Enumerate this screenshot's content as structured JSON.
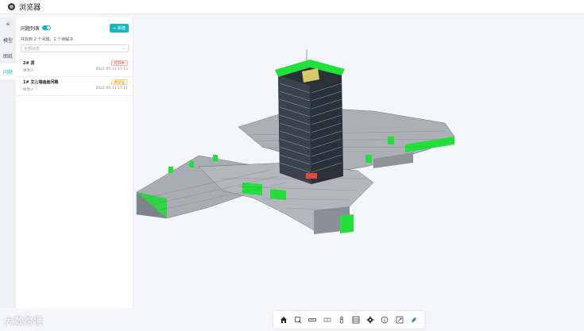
{
  "window": {
    "title": "浏览器"
  },
  "side_tabs": [
    {
      "label": "«"
    },
    {
      "label": "模型"
    },
    {
      "label": "图纸"
    },
    {
      "label": "问题"
    }
  ],
  "panel": {
    "title": "问题列表",
    "new_button": "+ 新建",
    "summary": "共找到 2 个问题，2 个待解决",
    "status_placeholder": "全部状态",
    "issues": [
      {
        "name": "2# 洞",
        "status": "打开中",
        "status_kind": "open",
        "owner": "修改人 - -",
        "date": "2022-05-11 17:13"
      },
      {
        "name": "1# 文儿墙画画问题",
        "status": "待验证",
        "status_kind": "pending",
        "owner": "修改人 - -",
        "date": "2022-05-11 17:11"
      }
    ]
  },
  "toolbar": {
    "tools": [
      "home-icon",
      "box-select-icon",
      "measure-icon",
      "section-icon",
      "person-icon",
      "layers-icon",
      "settings-icon",
      "info-icon",
      "fullscreen-icon",
      "logo-icon"
    ]
  },
  "watermark": "大数跨境",
  "colors": {
    "accent": "#13b8c2",
    "building_green": "#22e03a",
    "slab_gray": "#9a9fa6"
  }
}
